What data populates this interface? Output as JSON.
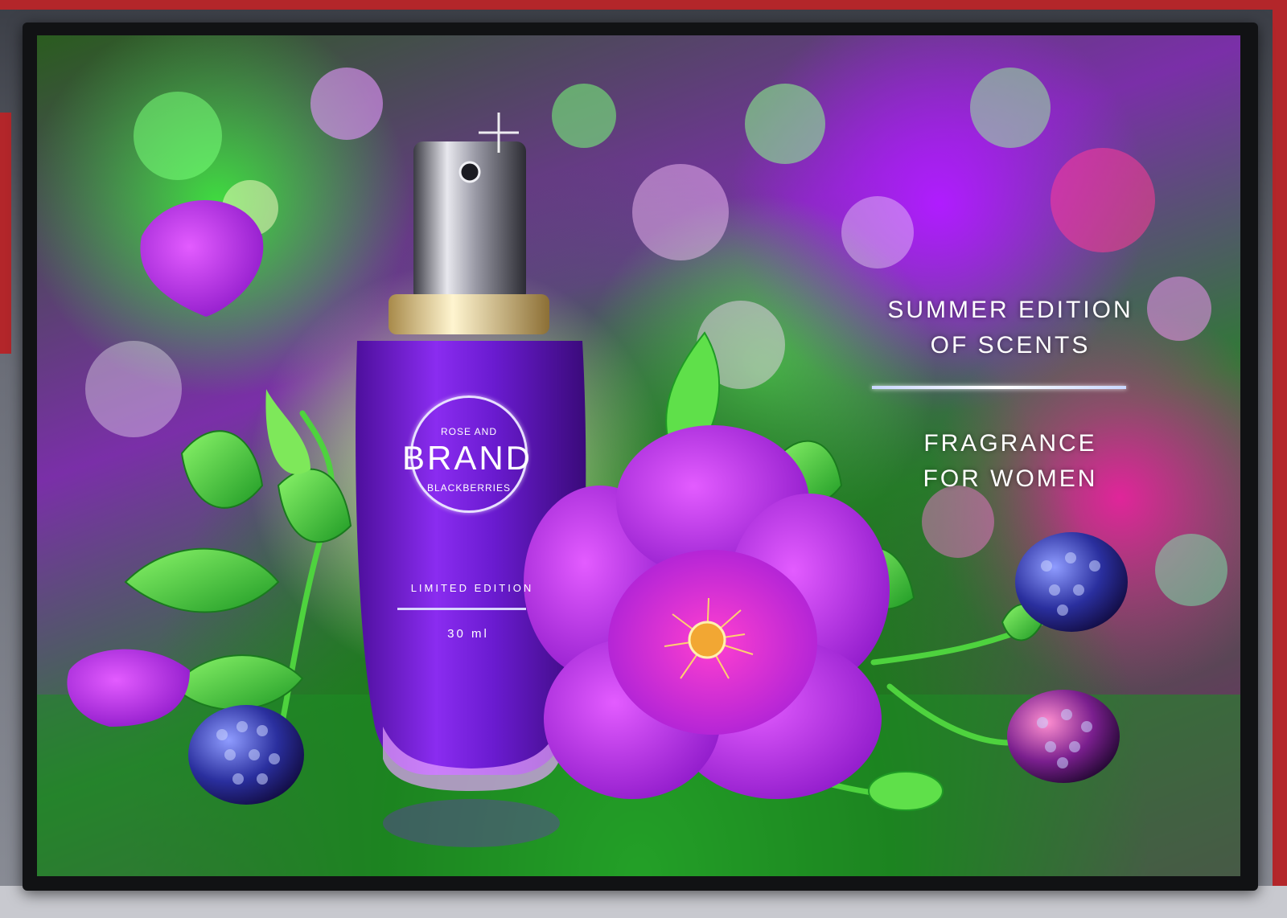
{
  "ad": {
    "headline_line1": "SUMMER EDITION",
    "headline_line2": "OF SCENTS",
    "subline_line1": "FRAGRANCE",
    "subline_line2": "FOR WOMEN"
  },
  "bottle_label": {
    "top": "ROSE AND",
    "brand": "BRAND",
    "bottom": "BLACKBERRIES",
    "edition": "LIMITED EDITION",
    "volume": "30 ml"
  },
  "colors": {
    "bottle_purple": "#7b1fd1",
    "flower_magenta": "#c02bff",
    "leaf_green": "#3fcf3a",
    "blackberry_blue": "#2a2f9e",
    "text_white": "#ffffff"
  },
  "objects": [
    "perfume-bottle",
    "wild-rose-flower",
    "blackberries",
    "rose-petals",
    "green-leaves",
    "rose-buds",
    "light-box-frame"
  ]
}
